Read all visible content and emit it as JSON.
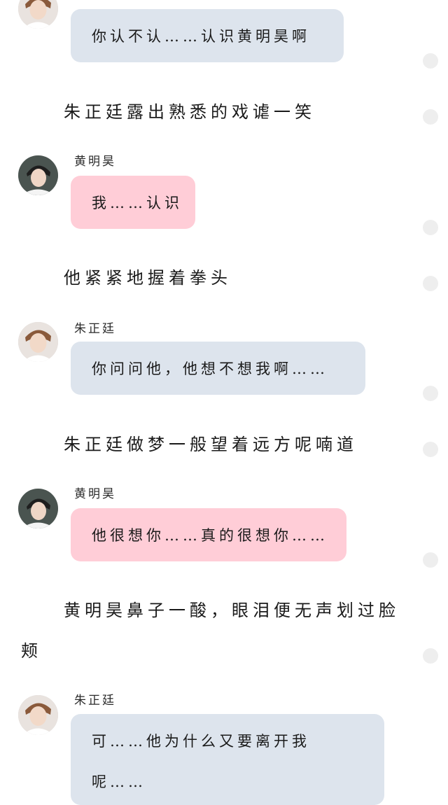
{
  "colors": {
    "blue_bubble": "#dde4ed",
    "pink_bubble": "#ffcdd7",
    "text": "#1a1a1a",
    "side_dot": "#eeeeee"
  },
  "messages": [
    {
      "speaker": "",
      "avatar": "zhu-avatar",
      "bubble_color": "blue",
      "text": "你认不认……认识黄明昊啊"
    },
    {
      "narration": "朱正廷露出熟悉的戏谑一笑"
    },
    {
      "speaker": "黄明昊",
      "avatar": "huang-avatar",
      "bubble_color": "pink",
      "text": "我……认识"
    },
    {
      "narration": "他紧紧地握着拳头"
    },
    {
      "speaker": "朱正廷",
      "avatar": "zhu-avatar",
      "bubble_color": "blue",
      "text": "你问问他，他想不想我啊……"
    },
    {
      "narration": "朱正廷做梦一般望着远方呢喃道"
    },
    {
      "speaker": "黄明昊",
      "avatar": "huang-avatar",
      "bubble_color": "pink",
      "text": "他很想你……真的很想你……"
    },
    {
      "narration_line1": "黄明昊鼻子一酸，眼泪便无声划过脸",
      "narration_line2": "颊"
    },
    {
      "speaker": "朱正廷",
      "avatar": "zhu-avatar",
      "bubble_color": "blue",
      "text_line1": "可……他为什么又要离开我",
      "text_line2": "呢……"
    }
  ]
}
